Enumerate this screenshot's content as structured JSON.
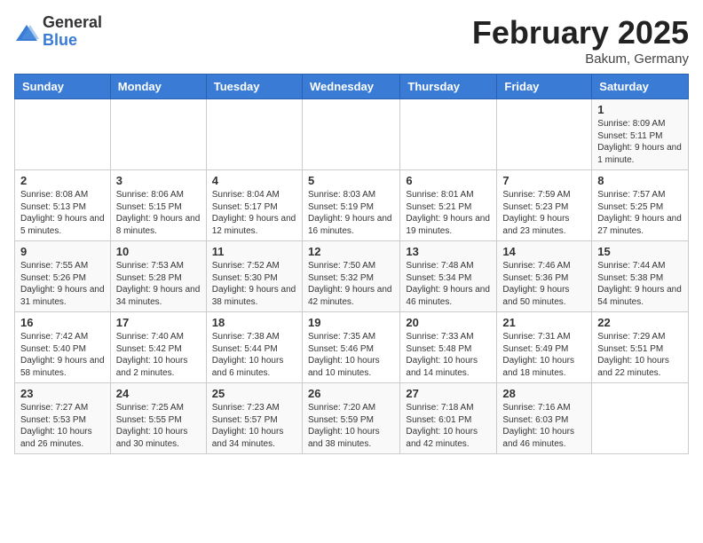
{
  "header": {
    "logo": {
      "general": "General",
      "blue": "Blue"
    },
    "title": "February 2025",
    "location": "Bakum, Germany"
  },
  "weekdays": [
    "Sunday",
    "Monday",
    "Tuesday",
    "Wednesday",
    "Thursday",
    "Friday",
    "Saturday"
  ],
  "weeks": [
    [
      null,
      null,
      null,
      null,
      null,
      null,
      {
        "day": "1",
        "info": "Sunrise: 8:09 AM\nSunset: 5:11 PM\nDaylight: 9 hours and 1 minute."
      }
    ],
    [
      {
        "day": "2",
        "info": "Sunrise: 8:08 AM\nSunset: 5:13 PM\nDaylight: 9 hours and 5 minutes."
      },
      {
        "day": "3",
        "info": "Sunrise: 8:06 AM\nSunset: 5:15 PM\nDaylight: 9 hours and 8 minutes."
      },
      {
        "day": "4",
        "info": "Sunrise: 8:04 AM\nSunset: 5:17 PM\nDaylight: 9 hours and 12 minutes."
      },
      {
        "day": "5",
        "info": "Sunrise: 8:03 AM\nSunset: 5:19 PM\nDaylight: 9 hours and 16 minutes."
      },
      {
        "day": "6",
        "info": "Sunrise: 8:01 AM\nSunset: 5:21 PM\nDaylight: 9 hours and 19 minutes."
      },
      {
        "day": "7",
        "info": "Sunrise: 7:59 AM\nSunset: 5:23 PM\nDaylight: 9 hours and 23 minutes."
      },
      {
        "day": "8",
        "info": "Sunrise: 7:57 AM\nSunset: 5:25 PM\nDaylight: 9 hours and 27 minutes."
      }
    ],
    [
      {
        "day": "9",
        "info": "Sunrise: 7:55 AM\nSunset: 5:26 PM\nDaylight: 9 hours and 31 minutes."
      },
      {
        "day": "10",
        "info": "Sunrise: 7:53 AM\nSunset: 5:28 PM\nDaylight: 9 hours and 34 minutes."
      },
      {
        "day": "11",
        "info": "Sunrise: 7:52 AM\nSunset: 5:30 PM\nDaylight: 9 hours and 38 minutes."
      },
      {
        "day": "12",
        "info": "Sunrise: 7:50 AM\nSunset: 5:32 PM\nDaylight: 9 hours and 42 minutes."
      },
      {
        "day": "13",
        "info": "Sunrise: 7:48 AM\nSunset: 5:34 PM\nDaylight: 9 hours and 46 minutes."
      },
      {
        "day": "14",
        "info": "Sunrise: 7:46 AM\nSunset: 5:36 PM\nDaylight: 9 hours and 50 minutes."
      },
      {
        "day": "15",
        "info": "Sunrise: 7:44 AM\nSunset: 5:38 PM\nDaylight: 9 hours and 54 minutes."
      }
    ],
    [
      {
        "day": "16",
        "info": "Sunrise: 7:42 AM\nSunset: 5:40 PM\nDaylight: 9 hours and 58 minutes."
      },
      {
        "day": "17",
        "info": "Sunrise: 7:40 AM\nSunset: 5:42 PM\nDaylight: 10 hours and 2 minutes."
      },
      {
        "day": "18",
        "info": "Sunrise: 7:38 AM\nSunset: 5:44 PM\nDaylight: 10 hours and 6 minutes."
      },
      {
        "day": "19",
        "info": "Sunrise: 7:35 AM\nSunset: 5:46 PM\nDaylight: 10 hours and 10 minutes."
      },
      {
        "day": "20",
        "info": "Sunrise: 7:33 AM\nSunset: 5:48 PM\nDaylight: 10 hours and 14 minutes."
      },
      {
        "day": "21",
        "info": "Sunrise: 7:31 AM\nSunset: 5:49 PM\nDaylight: 10 hours and 18 minutes."
      },
      {
        "day": "22",
        "info": "Sunrise: 7:29 AM\nSunset: 5:51 PM\nDaylight: 10 hours and 22 minutes."
      }
    ],
    [
      {
        "day": "23",
        "info": "Sunrise: 7:27 AM\nSunset: 5:53 PM\nDaylight: 10 hours and 26 minutes."
      },
      {
        "day": "24",
        "info": "Sunrise: 7:25 AM\nSunset: 5:55 PM\nDaylight: 10 hours and 30 minutes."
      },
      {
        "day": "25",
        "info": "Sunrise: 7:23 AM\nSunset: 5:57 PM\nDaylight: 10 hours and 34 minutes."
      },
      {
        "day": "26",
        "info": "Sunrise: 7:20 AM\nSunset: 5:59 PM\nDaylight: 10 hours and 38 minutes."
      },
      {
        "day": "27",
        "info": "Sunrise: 7:18 AM\nSunset: 6:01 PM\nDaylight: 10 hours and 42 minutes."
      },
      {
        "day": "28",
        "info": "Sunrise: 7:16 AM\nSunset: 6:03 PM\nDaylight: 10 hours and 46 minutes."
      },
      null
    ]
  ]
}
